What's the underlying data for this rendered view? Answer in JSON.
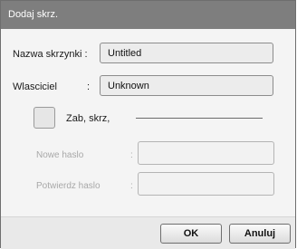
{
  "window": {
    "title": "Dodaj skrz."
  },
  "form": {
    "mailbox_name": {
      "label": "Nazwa skrzynki :",
      "value": "Untitled"
    },
    "owner": {
      "label": "Wlasciciel",
      "colon": ":",
      "value": "Unknown"
    },
    "protect": {
      "label": "Zab, skrz,"
    },
    "new_password": {
      "label": "Nowe haslo",
      "colon": ":",
      "value": ""
    },
    "confirm_password": {
      "label": "Potwierdz haslo",
      "colon": ":",
      "value": ""
    }
  },
  "buttons": {
    "ok": "OK",
    "cancel": "Anuluj"
  }
}
